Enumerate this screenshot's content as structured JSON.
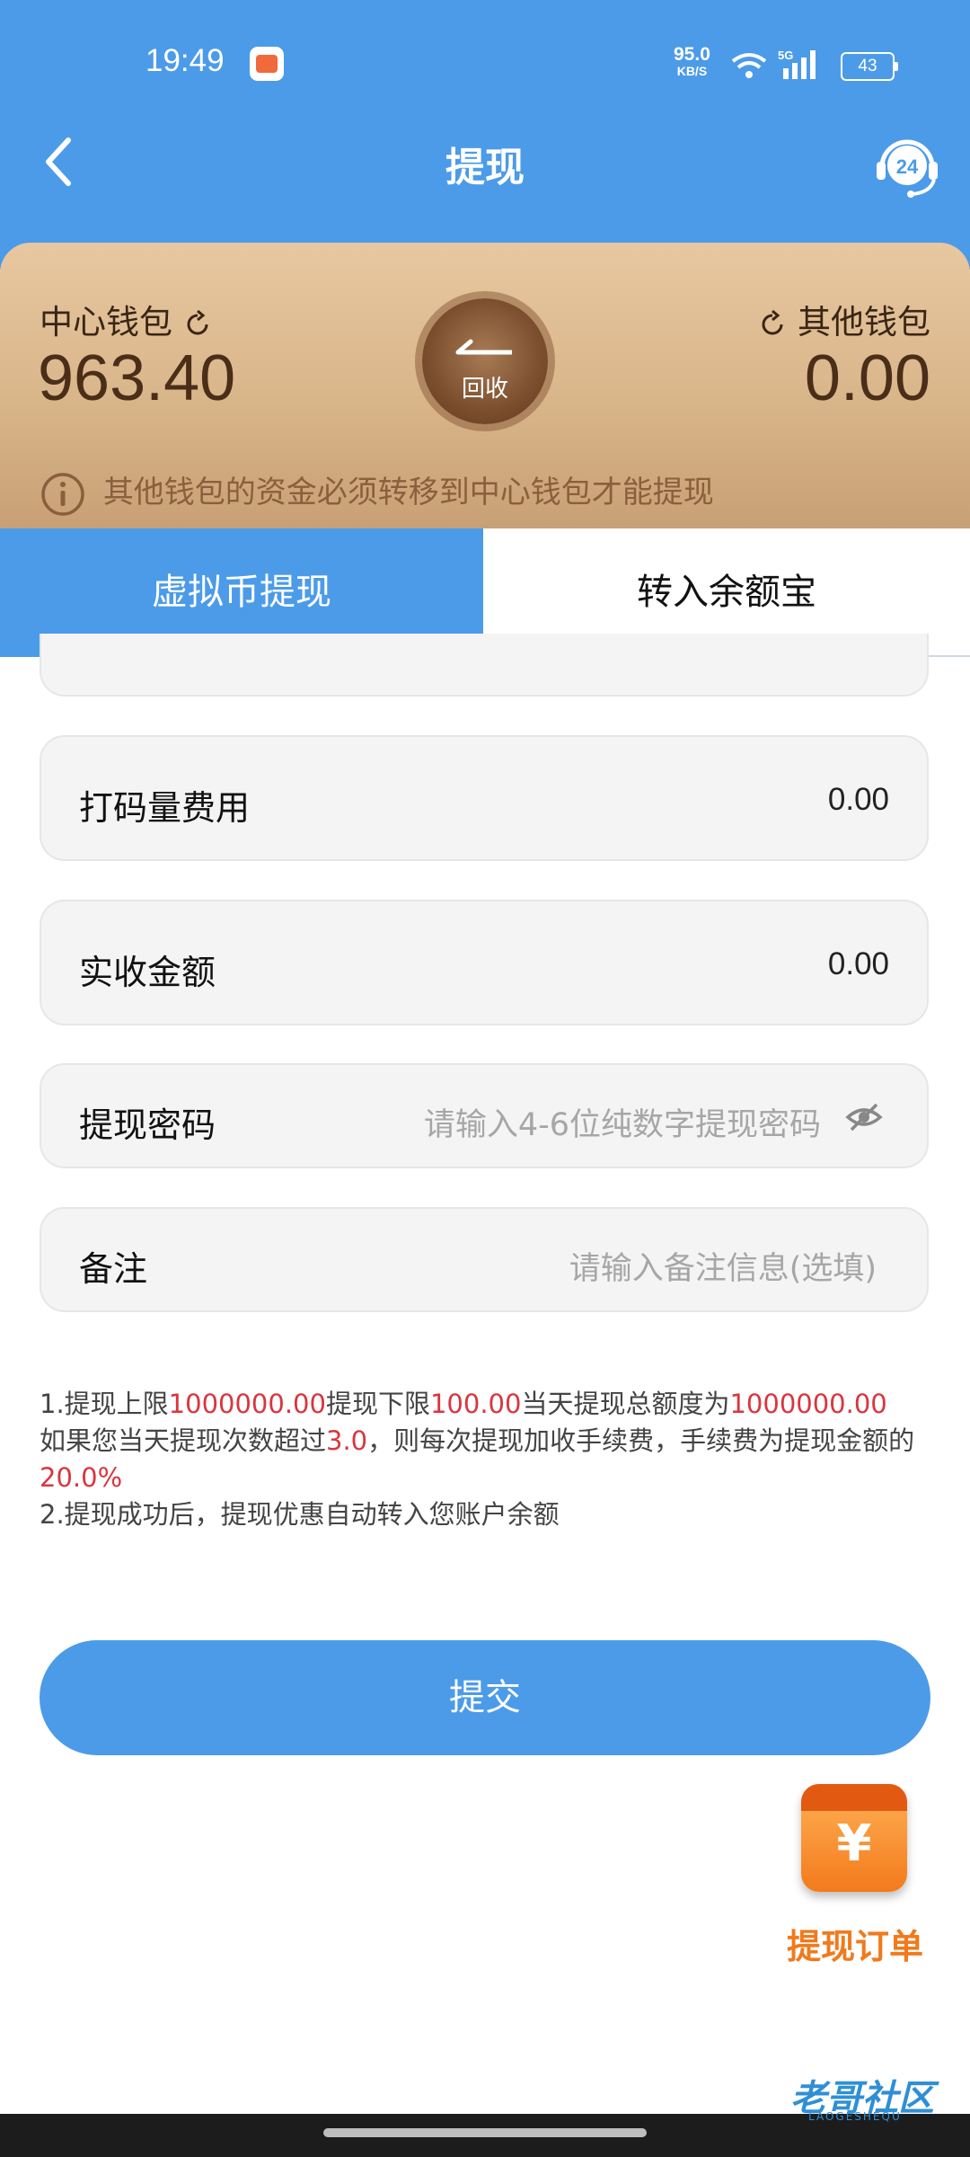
{
  "status_bar": {
    "time": "19:49",
    "net_speed": "95.0",
    "net_unit": "KB/S",
    "network": "5G",
    "battery": "43"
  },
  "header": {
    "title": "提现"
  },
  "support": {
    "badge": "24"
  },
  "wallet": {
    "center_label": "中心钱包",
    "center_amount": "963.40",
    "other_label": "其他钱包",
    "other_amount": "0.00",
    "recycle_label": "回收",
    "notice": "其他钱包的资金必须转移到中心钱包才能提现"
  },
  "tabs": [
    {
      "label": "虚拟币提现",
      "active": true
    },
    {
      "label": "转入余额宝",
      "active": false
    }
  ],
  "fields": {
    "fee": {
      "label": "打码量费用",
      "value": "0.00"
    },
    "actual": {
      "label": "实收金额",
      "value": "0.00"
    },
    "password": {
      "label": "提现密码",
      "placeholder": "请输入4-6位纯数字提现密码"
    },
    "remark": {
      "label": "备注",
      "placeholder": "请输入备注信息(选填)"
    }
  },
  "rules": {
    "l1_a": "1.提现上限",
    "max": "1000000.00",
    "l1_b": "提现下限",
    "min": "100.00",
    "l1_c": "当天提现总额度为",
    "daily_total": "1000000.00",
    "l2_a": "如果您当天提现次数超过",
    "times": "3.0",
    "l2_b": "，则每次提现加收手续费，手续费为提现金额的",
    "fee_rate": "20.0%",
    "l3": "2.提现成功后，提现优惠自动转入您账户余额"
  },
  "submit_label": "提交",
  "order": {
    "label": "提现订单",
    "symbol": "¥"
  },
  "watermark": {
    "text": "老哥社区",
    "sub": "LAOGESHEQU"
  },
  "colors": {
    "primary": "#4c9be8",
    "accent_red": "#d9363e",
    "wallet_brown": "#4a2e18"
  }
}
